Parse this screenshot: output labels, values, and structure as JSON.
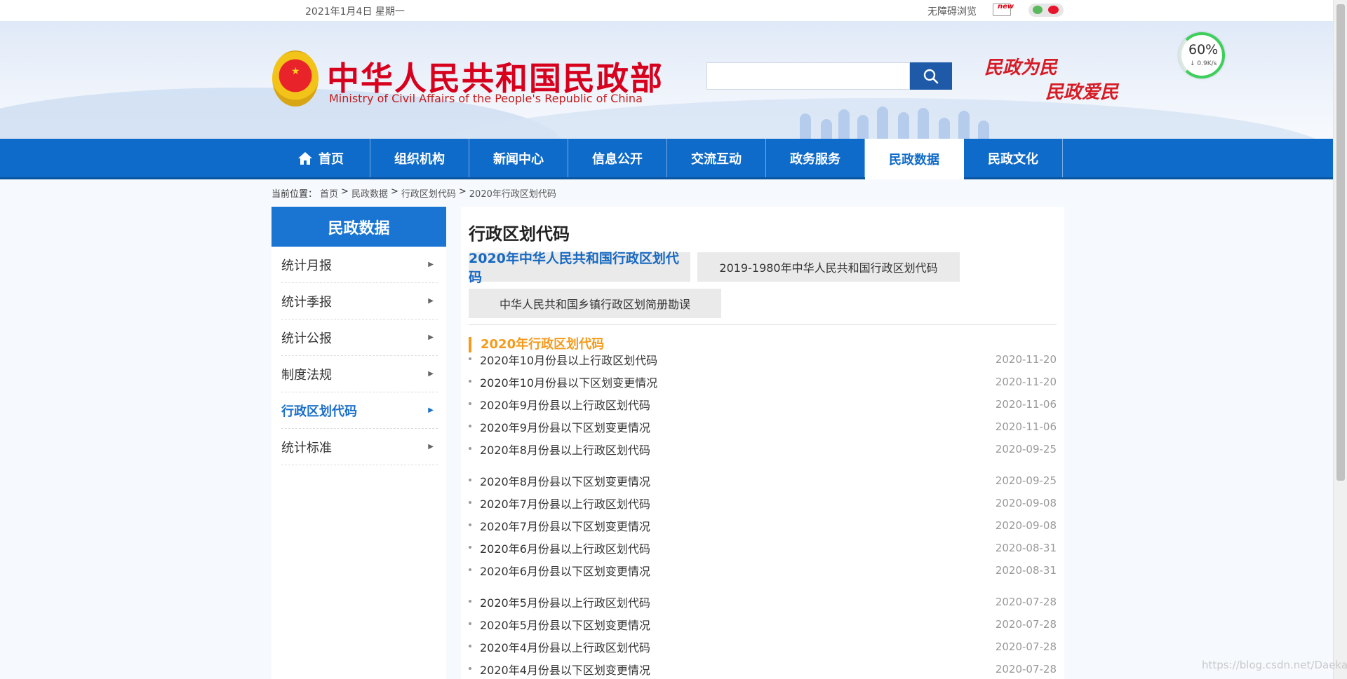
{
  "topbar": {
    "date": "2021年1月4日 星期一",
    "accessibility": "无障碍浏览",
    "new_badge": "new"
  },
  "header": {
    "title": "中华人民共和国民政部",
    "subtitle": "Ministry of Civil Affairs of the People's Republic of China",
    "search_placeholder": "",
    "slogan_line1": "民政为民",
    "slogan_line2": "民政爱民",
    "brand_color": "#d7001d"
  },
  "speed_widget": {
    "percent": "60%",
    "rate": "↓ 0.9K/s"
  },
  "nav": {
    "items": [
      {
        "label": "首页",
        "icon": "home-icon"
      },
      {
        "label": "组织机构"
      },
      {
        "label": "新闻中心"
      },
      {
        "label": "信息公开"
      },
      {
        "label": "交流互动"
      },
      {
        "label": "政务服务"
      },
      {
        "label": "民政数据",
        "active": true
      },
      {
        "label": "民政文化"
      }
    ],
    "color": "#0f6bc9"
  },
  "breadcrumb": {
    "prefix": "当前位置：",
    "crumbs": [
      "首页",
      "民政数据",
      "行政区划代码",
      "2020年行政区划代码"
    ]
  },
  "sidebar": {
    "title": "民政数据",
    "items": [
      {
        "label": "统计月报"
      },
      {
        "label": "统计季报"
      },
      {
        "label": "统计公报"
      },
      {
        "label": "制度法规"
      },
      {
        "label": "行政区划代码",
        "active": true
      },
      {
        "label": "统计标准"
      }
    ]
  },
  "main": {
    "title": "行政区划代码",
    "tabs": [
      {
        "label": "2020年中华人民共和国行政区划代码",
        "active": true
      },
      {
        "label": "2019-1980年中华人民共和国行政区划代码"
      },
      {
        "label": "中华人民共和国乡镇行政区划简册勘误"
      }
    ],
    "section_title": "2020年行政区划代码",
    "list": [
      {
        "title": "2020年10月份县以上行政区划代码",
        "date": "2020-11-20"
      },
      {
        "title": "2020年10月份县以下区划变更情况",
        "date": "2020-11-20"
      },
      {
        "title": "2020年9月份县以上行政区划代码",
        "date": "2020-11-06"
      },
      {
        "title": "2020年9月份县以下区划变更情况",
        "date": "2020-11-06"
      },
      {
        "title": "2020年8月份县以上行政区划代码",
        "date": "2020-09-25"
      },
      {
        "title": "2020年8月份县以下区划变更情况",
        "date": "2020-09-25"
      },
      {
        "title": "2020年7月份县以上行政区划代码",
        "date": "2020-09-08"
      },
      {
        "title": "2020年7月份县以下区划变更情况",
        "date": "2020-09-08"
      },
      {
        "title": "2020年6月份县以上行政区划代码",
        "date": "2020-08-31"
      },
      {
        "title": "2020年6月份县以下区划变更情况",
        "date": "2020-08-31"
      },
      {
        "title": "2020年5月份县以上行政区划代码",
        "date": "2020-07-28"
      },
      {
        "title": "2020年5月份县以下区划变更情况",
        "date": "2020-07-28"
      },
      {
        "title": "2020年4月份县以上行政区划代码",
        "date": "2020-07-28"
      },
      {
        "title": "2020年4月份县以下区划变更情况",
        "date": "2020-07-28"
      }
    ]
  },
  "watermark": "https://blog.csdn.net/Daeka"
}
